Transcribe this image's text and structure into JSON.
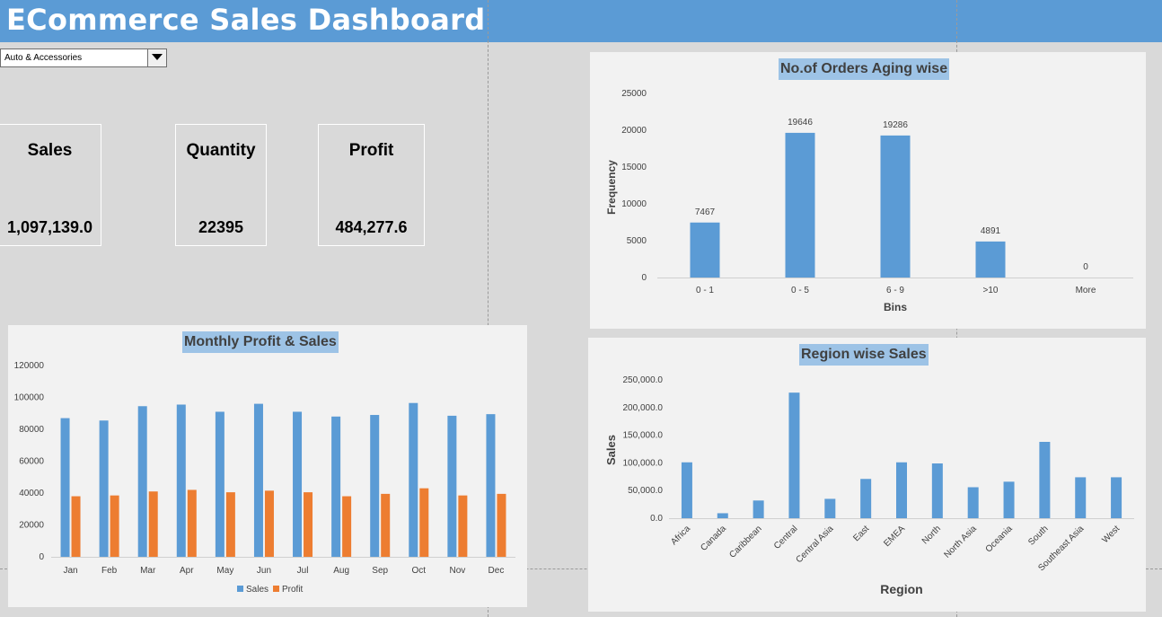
{
  "header": {
    "title": "ECommerce Sales Dashboard"
  },
  "filter": {
    "selected": "Auto & Accessories"
  },
  "kpis": [
    {
      "label": "Sales",
      "value": "1,097,139.0"
    },
    {
      "label": "Quantity",
      "value": "22395"
    },
    {
      "label": "Profit",
      "value": "484,277.6"
    }
  ],
  "colors": {
    "header": "#5b9bd5",
    "sales": "#5b9bd5",
    "profit": "#ed7d31",
    "title_bg": "#9dc3e6"
  },
  "chart_data": [
    {
      "id": "aging",
      "type": "bar",
      "title": "No.of Orders Aging wise",
      "xlabel": "Bins",
      "ylabel": "Frequency",
      "categories": [
        "0 - 1",
        "0 - 5",
        "6 - 9",
        ">10",
        "More"
      ],
      "values": [
        7467,
        19646,
        19286,
        4891,
        0
      ],
      "data_labels": [
        "7467",
        "19646",
        "19286",
        "4891",
        "0"
      ],
      "ylim": [
        0,
        25000
      ],
      "yticks": [
        "0",
        "5000",
        "10000",
        "15000",
        "20000",
        "25000"
      ],
      "grid": false
    },
    {
      "id": "monthly",
      "type": "bar",
      "title": "Monthly Profit & Sales",
      "categories": [
        "Jan",
        "Feb",
        "Mar",
        "Apr",
        "May",
        "Jun",
        "Jul",
        "Aug",
        "Sep",
        "Oct",
        "Nov",
        "Dec"
      ],
      "series": [
        {
          "name": "Sales",
          "values": [
            87000,
            85500,
            94500,
            95500,
            91000,
            96000,
            91000,
            88000,
            89000,
            96500,
            88500,
            89500
          ]
        },
        {
          "name": "Profit",
          "values": [
            38000,
            38500,
            41000,
            42000,
            40500,
            41500,
            40500,
            38000,
            39500,
            43000,
            38500,
            39500
          ]
        }
      ],
      "ylim": [
        0,
        120000
      ],
      "yticks": [
        "0",
        "20000",
        "40000",
        "60000",
        "80000",
        "100000",
        "120000"
      ],
      "legend": "bottom",
      "grid": false
    },
    {
      "id": "region",
      "type": "bar",
      "title": "Region wise Sales",
      "xlabel": "Region",
      "ylabel": "Sales",
      "categories": [
        "Africa",
        "Canada",
        "Caribbean",
        "Central",
        "Central Asia",
        "East",
        "EMEA",
        "North",
        "North Asia",
        "Oceania",
        "South",
        "Southeast Asia",
        "West"
      ],
      "values": [
        101000,
        9000,
        32000,
        227000,
        35000,
        71000,
        101000,
        99000,
        56000,
        66000,
        138000,
        74000,
        74000
      ],
      "ylim": [
        0,
        250000
      ],
      "yticks": [
        "0.0",
        "50,000.0",
        "100,000.0",
        "150,000.0",
        "200,000.0",
        "250,000.0"
      ],
      "grid": false
    }
  ]
}
